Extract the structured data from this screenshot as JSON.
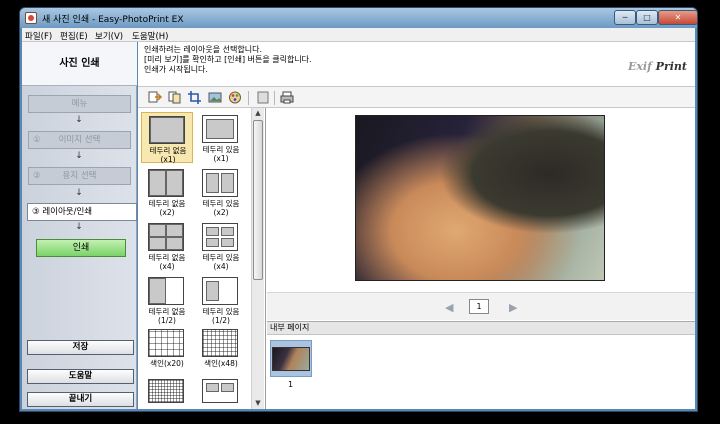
{
  "window": {
    "title": "새 사진 인쇄 - Easy-PhotoPrint EX",
    "minimize": "─",
    "maximize": "□",
    "close": "✕"
  },
  "menu": [
    "파일(F)",
    "편집(E)",
    "보기(V)",
    "도움말(H)"
  ],
  "sidebar": {
    "title": "사진 인쇄",
    "steps": [
      {
        "num": "",
        "label": "메뉴"
      },
      {
        "num": "①",
        "label": "이미지 선택"
      },
      {
        "num": "②",
        "label": "용지 선택"
      },
      {
        "num": "③",
        "label": "레이아웃/인쇄"
      }
    ],
    "arrow": "↓",
    "print_button": "인쇄",
    "save_button": "저장",
    "help_button": "도움말",
    "exit_button": "끝내기"
  },
  "instructions": [
    "인쇄하려는 레이아웃을 선택합니다.",
    "[미리 보기]를 확인하고 [인쇄] 버튼을 클릭합니다.",
    "인쇄가 시작됩니다."
  ],
  "logo": {
    "exif": "Exif",
    "print": "Print"
  },
  "toolbar": {
    "icons": [
      "page-forward-icon",
      "copy-page-icon",
      "crop-icon",
      "image-adjust-icon",
      "color-palette-icon",
      "fill-page-icon",
      "print-settings-icon"
    ]
  },
  "layouts": [
    {
      "label1": "테두리 없음",
      "label2": "(x1)"
    },
    {
      "label1": "테두리 있음",
      "label2": "(x1)"
    },
    {
      "label1": "테두리 없음",
      "label2": "(x2)"
    },
    {
      "label1": "테두리 있음",
      "label2": "(x2)"
    },
    {
      "label1": "테두리 없음",
      "label2": "(x4)"
    },
    {
      "label1": "테두리 있음",
      "label2": "(x4)"
    },
    {
      "label1": "테두리 없음",
      "label2": "(1/2)"
    },
    {
      "label1": "테두리 있음",
      "label2": "(1/2)"
    },
    {
      "label1": "색인(x20)",
      "label2": ""
    },
    {
      "label1": "색인(x48)",
      "label2": ""
    }
  ],
  "pager": {
    "page": "1",
    "prev": "◀",
    "next": "▶"
  },
  "internal_pages": {
    "header": "내부 페이지",
    "page_label": "1"
  },
  "scroll": {
    "up": "▲",
    "down": "▼"
  }
}
